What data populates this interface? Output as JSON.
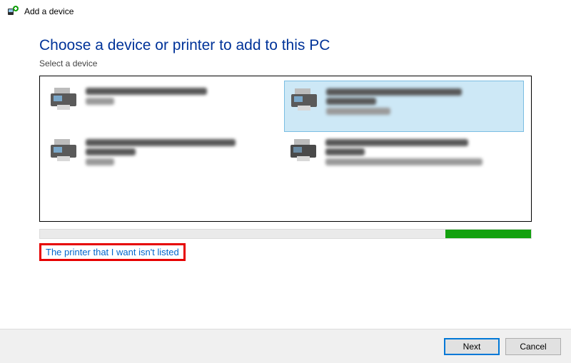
{
  "titlebar": {
    "title": "Add a device"
  },
  "main": {
    "heading": "Choose a device or printer to add to this PC",
    "subheading": "Select a device"
  },
  "devices": [
    {
      "name": "(redacted)",
      "type": "Printer",
      "selected": false
    },
    {
      "name": "(redacted)",
      "type": "Printer, Scanner",
      "selected": true
    },
    {
      "name": "(redacted)",
      "type": "Printer",
      "selected": false
    },
    {
      "name": "(redacted)",
      "type": "Multi Function Printer, Printer, Scan...",
      "selected": false
    }
  ],
  "link": {
    "not_listed": "The printer that I want isn't listed"
  },
  "footer": {
    "next": "Next",
    "cancel": "Cancel"
  },
  "icons": {
    "title": "device-add-icon",
    "printer": "printer-icon"
  }
}
